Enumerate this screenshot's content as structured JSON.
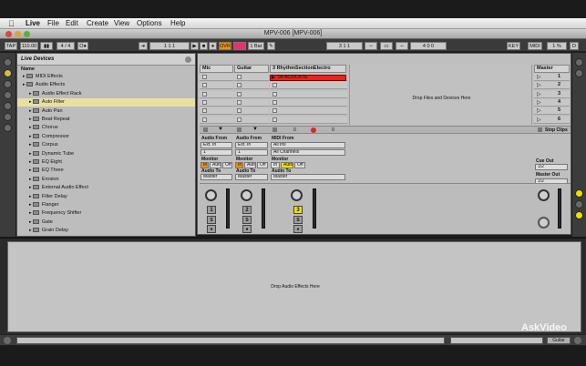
{
  "menubar": {
    "app_name": "Live",
    "items": [
      "File",
      "Edit",
      "Create",
      "View",
      "Options",
      "Help"
    ]
  },
  "window": {
    "title": "MPV-006  [MPV-006]"
  },
  "transport": {
    "tap_label": "TAP",
    "tempo": "110.00",
    "time_signature": "4 / 4",
    "metronome": "O●",
    "position": "1   1   1",
    "ovr_label": "OVR",
    "quantize": "1 Bar",
    "loop_start": "3   1   1",
    "loop_length": "4   0   0",
    "key_label": "KEY",
    "midi_label": "MIDI",
    "cpu": "1 %",
    "d_label": "D"
  },
  "browser": {
    "title": "Live Devices",
    "column_name": "Name",
    "items": [
      {
        "label": "MIDI Effects",
        "level": 0,
        "selected": false
      },
      {
        "label": "Audio Effects",
        "level": 0,
        "selected": false
      },
      {
        "label": "Audio Effect Rack",
        "level": 1,
        "selected": false
      },
      {
        "label": "Auto Filter",
        "level": 1,
        "selected": true
      },
      {
        "label": "Auto Pan",
        "level": 1,
        "selected": false
      },
      {
        "label": "Beat Repeat",
        "level": 1,
        "selected": false
      },
      {
        "label": "Chorus",
        "level": 1,
        "selected": false
      },
      {
        "label": "Compressor",
        "level": 1,
        "selected": false
      },
      {
        "label": "Corpus",
        "level": 1,
        "selected": false
      },
      {
        "label": "Dynamic Tube",
        "level": 1,
        "selected": false
      },
      {
        "label": "EQ Eight",
        "level": 1,
        "selected": false
      },
      {
        "label": "EQ Three",
        "level": 1,
        "selected": false
      },
      {
        "label": "Erosion",
        "level": 1,
        "selected": false
      },
      {
        "label": "External Audio Effect",
        "level": 1,
        "selected": false
      },
      {
        "label": "Filter Delay",
        "level": 1,
        "selected": false
      },
      {
        "label": "Flanger",
        "level": 1,
        "selected": false
      },
      {
        "label": "Frequency Shifter",
        "level": 1,
        "selected": false
      },
      {
        "label": "Gate",
        "level": 1,
        "selected": false
      },
      {
        "label": "Grain Delay",
        "level": 1,
        "selected": false
      }
    ]
  },
  "session": {
    "drop_files_hint": "Drop Files and Devices Here",
    "clip_name": "04-ACIDCKTE",
    "tracks": [
      {
        "name": "Mic",
        "number": "1",
        "audio_from_label": "Audio From",
        "audio_from": "Ext. In",
        "input_channel": "1",
        "monitor_label": "Monitor",
        "monitor_options": [
          "In",
          "Auto",
          "Off"
        ],
        "audio_to_label": "Audio To",
        "audio_to": "Master"
      },
      {
        "name": "Guitar",
        "number": "2",
        "audio_from_label": "Audio From",
        "audio_from": "Ext. In",
        "input_channel": "1",
        "monitor_label": "Monitor",
        "monitor_options": [
          "In",
          "Auto",
          "Off"
        ],
        "audio_to_label": "Audio To",
        "audio_to": "Master"
      },
      {
        "name": "3 RhythmSectionElectro",
        "number": "3",
        "audio_from_label": "MIDI From",
        "audio_from": "All Ins",
        "input_channel": "All Channels",
        "monitor_label": "Monitor",
        "monitor_options": [
          "In",
          "Auto",
          "Off"
        ],
        "audio_to_label": "Audio To",
        "audio_to": "Master"
      }
    ],
    "master": {
      "name": "Master",
      "scenes": [
        "1",
        "2",
        "3",
        "4",
        "5",
        "6"
      ],
      "stop_clips": "Stop Clips",
      "cue_out_label": "Cue Out",
      "cue_out": "1/2",
      "master_out_label": "Master Out",
      "master_out": "1/2"
    },
    "sends": {
      "left": "0",
      "right": "0"
    }
  },
  "detail": {
    "drop_effects_hint": "Drop Audio Effects Here"
  },
  "statusbar": {
    "track_label": "Guitar"
  },
  "watermark": "AskVideo",
  "colors": {
    "selected_item": "#e8e0a0",
    "clip_red": "#e8241c",
    "arm_yellow": "#f0e000",
    "ovr_orange": "#f09000"
  }
}
